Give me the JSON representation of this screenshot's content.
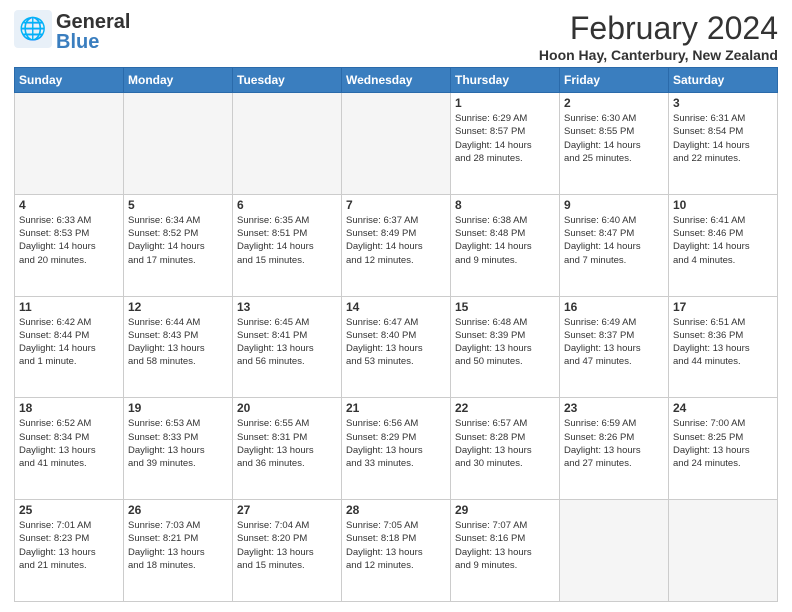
{
  "header": {
    "logo_general": "General",
    "logo_blue": "Blue",
    "month_title": "February 2024",
    "location": "Hoon Hay, Canterbury, New Zealand"
  },
  "weekdays": [
    "Sunday",
    "Monday",
    "Tuesday",
    "Wednesday",
    "Thursday",
    "Friday",
    "Saturday"
  ],
  "weeks": [
    [
      {
        "day": "",
        "info": ""
      },
      {
        "day": "",
        "info": ""
      },
      {
        "day": "",
        "info": ""
      },
      {
        "day": "",
        "info": ""
      },
      {
        "day": "1",
        "info": "Sunrise: 6:29 AM\nSunset: 8:57 PM\nDaylight: 14 hours\nand 28 minutes."
      },
      {
        "day": "2",
        "info": "Sunrise: 6:30 AM\nSunset: 8:55 PM\nDaylight: 14 hours\nand 25 minutes."
      },
      {
        "day": "3",
        "info": "Sunrise: 6:31 AM\nSunset: 8:54 PM\nDaylight: 14 hours\nand 22 minutes."
      }
    ],
    [
      {
        "day": "4",
        "info": "Sunrise: 6:33 AM\nSunset: 8:53 PM\nDaylight: 14 hours\nand 20 minutes."
      },
      {
        "day": "5",
        "info": "Sunrise: 6:34 AM\nSunset: 8:52 PM\nDaylight: 14 hours\nand 17 minutes."
      },
      {
        "day": "6",
        "info": "Sunrise: 6:35 AM\nSunset: 8:51 PM\nDaylight: 14 hours\nand 15 minutes."
      },
      {
        "day": "7",
        "info": "Sunrise: 6:37 AM\nSunset: 8:49 PM\nDaylight: 14 hours\nand 12 minutes."
      },
      {
        "day": "8",
        "info": "Sunrise: 6:38 AM\nSunset: 8:48 PM\nDaylight: 14 hours\nand 9 minutes."
      },
      {
        "day": "9",
        "info": "Sunrise: 6:40 AM\nSunset: 8:47 PM\nDaylight: 14 hours\nand 7 minutes."
      },
      {
        "day": "10",
        "info": "Sunrise: 6:41 AM\nSunset: 8:46 PM\nDaylight: 14 hours\nand 4 minutes."
      }
    ],
    [
      {
        "day": "11",
        "info": "Sunrise: 6:42 AM\nSunset: 8:44 PM\nDaylight: 14 hours\nand 1 minute."
      },
      {
        "day": "12",
        "info": "Sunrise: 6:44 AM\nSunset: 8:43 PM\nDaylight: 13 hours\nand 58 minutes."
      },
      {
        "day": "13",
        "info": "Sunrise: 6:45 AM\nSunset: 8:41 PM\nDaylight: 13 hours\nand 56 minutes."
      },
      {
        "day": "14",
        "info": "Sunrise: 6:47 AM\nSunset: 8:40 PM\nDaylight: 13 hours\nand 53 minutes."
      },
      {
        "day": "15",
        "info": "Sunrise: 6:48 AM\nSunset: 8:39 PM\nDaylight: 13 hours\nand 50 minutes."
      },
      {
        "day": "16",
        "info": "Sunrise: 6:49 AM\nSunset: 8:37 PM\nDaylight: 13 hours\nand 47 minutes."
      },
      {
        "day": "17",
        "info": "Sunrise: 6:51 AM\nSunset: 8:36 PM\nDaylight: 13 hours\nand 44 minutes."
      }
    ],
    [
      {
        "day": "18",
        "info": "Sunrise: 6:52 AM\nSunset: 8:34 PM\nDaylight: 13 hours\nand 41 minutes."
      },
      {
        "day": "19",
        "info": "Sunrise: 6:53 AM\nSunset: 8:33 PM\nDaylight: 13 hours\nand 39 minutes."
      },
      {
        "day": "20",
        "info": "Sunrise: 6:55 AM\nSunset: 8:31 PM\nDaylight: 13 hours\nand 36 minutes."
      },
      {
        "day": "21",
        "info": "Sunrise: 6:56 AM\nSunset: 8:29 PM\nDaylight: 13 hours\nand 33 minutes."
      },
      {
        "day": "22",
        "info": "Sunrise: 6:57 AM\nSunset: 8:28 PM\nDaylight: 13 hours\nand 30 minutes."
      },
      {
        "day": "23",
        "info": "Sunrise: 6:59 AM\nSunset: 8:26 PM\nDaylight: 13 hours\nand 27 minutes."
      },
      {
        "day": "24",
        "info": "Sunrise: 7:00 AM\nSunset: 8:25 PM\nDaylight: 13 hours\nand 24 minutes."
      }
    ],
    [
      {
        "day": "25",
        "info": "Sunrise: 7:01 AM\nSunset: 8:23 PM\nDaylight: 13 hours\nand 21 minutes."
      },
      {
        "day": "26",
        "info": "Sunrise: 7:03 AM\nSunset: 8:21 PM\nDaylight: 13 hours\nand 18 minutes."
      },
      {
        "day": "27",
        "info": "Sunrise: 7:04 AM\nSunset: 8:20 PM\nDaylight: 13 hours\nand 15 minutes."
      },
      {
        "day": "28",
        "info": "Sunrise: 7:05 AM\nSunset: 8:18 PM\nDaylight: 13 hours\nand 12 minutes."
      },
      {
        "day": "29",
        "info": "Sunrise: 7:07 AM\nSunset: 8:16 PM\nDaylight: 13 hours\nand 9 minutes."
      },
      {
        "day": "",
        "info": ""
      },
      {
        "day": "",
        "info": ""
      }
    ]
  ]
}
